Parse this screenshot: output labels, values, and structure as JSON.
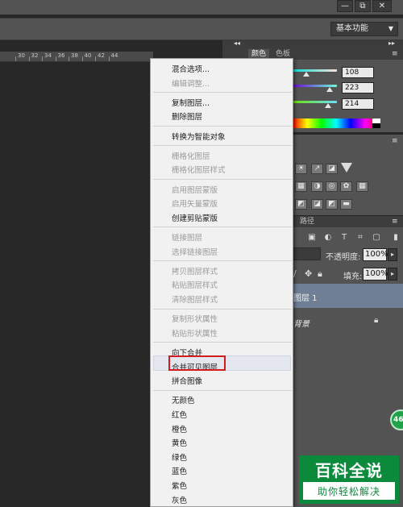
{
  "window": {
    "minimize": "—",
    "restore": "⧉",
    "close": "✕"
  },
  "workspace": {
    "value": "基本功能"
  },
  "ruler": {
    "ticks": [
      "30",
      "32",
      "34",
      "36",
      "38",
      "40",
      "42",
      "44"
    ]
  },
  "color_panel": {
    "tabs": [
      "颜色",
      "色板"
    ],
    "values": [
      "108",
      "223",
      "214"
    ],
    "accent": "#0b8a3c"
  },
  "layers_panel": {
    "tabs": [
      "路径"
    ],
    "opacity_label": "不透明度:",
    "opacity_value": "100%",
    "fill_label": "填充:",
    "fill_value": "100%",
    "layer_1": "图层 1",
    "background": "背景"
  },
  "context_menu": {
    "groups": [
      [
        {
          "label": "混合选项...",
          "enabled": true
        },
        {
          "label": "编辑调整...",
          "enabled": false
        }
      ],
      [
        {
          "label": "复制图层...",
          "enabled": true
        },
        {
          "label": "删除图层",
          "enabled": true
        }
      ],
      [
        {
          "label": "转换为智能对象",
          "enabled": true
        }
      ],
      [
        {
          "label": "栅格化图层",
          "enabled": false
        },
        {
          "label": "栅格化图层样式",
          "enabled": false
        }
      ],
      [
        {
          "label": "启用图层蒙版",
          "enabled": false
        },
        {
          "label": "启用矢量蒙版",
          "enabled": false
        },
        {
          "label": "创建剪贴蒙版",
          "enabled": true
        }
      ],
      [
        {
          "label": "链接图层",
          "enabled": false
        },
        {
          "label": "选择链接图层",
          "enabled": false
        }
      ],
      [
        {
          "label": "拷贝图层样式",
          "enabled": false
        },
        {
          "label": "粘贴图层样式",
          "enabled": false
        },
        {
          "label": "清除图层样式",
          "enabled": false
        }
      ],
      [
        {
          "label": "复制形状属性",
          "enabled": false
        },
        {
          "label": "粘贴形状属性",
          "enabled": false
        }
      ],
      [
        {
          "label": "向下合并",
          "enabled": true
        },
        {
          "label": "合并可见图层",
          "enabled": true,
          "highlighted": true
        },
        {
          "label": "拼合图像",
          "enabled": true
        }
      ],
      [
        {
          "label": "无颜色",
          "enabled": true
        },
        {
          "label": "红色",
          "enabled": true
        },
        {
          "label": "橙色",
          "enabled": true
        },
        {
          "label": "黄色",
          "enabled": true
        },
        {
          "label": "绿色",
          "enabled": true
        },
        {
          "label": "蓝色",
          "enabled": true
        },
        {
          "label": "紫色",
          "enabled": true
        },
        {
          "label": "灰色",
          "enabled": true
        }
      ]
    ]
  },
  "watermark": {
    "title": "百科全说",
    "subtitle": "助你轻松解决",
    "badge": "46"
  }
}
